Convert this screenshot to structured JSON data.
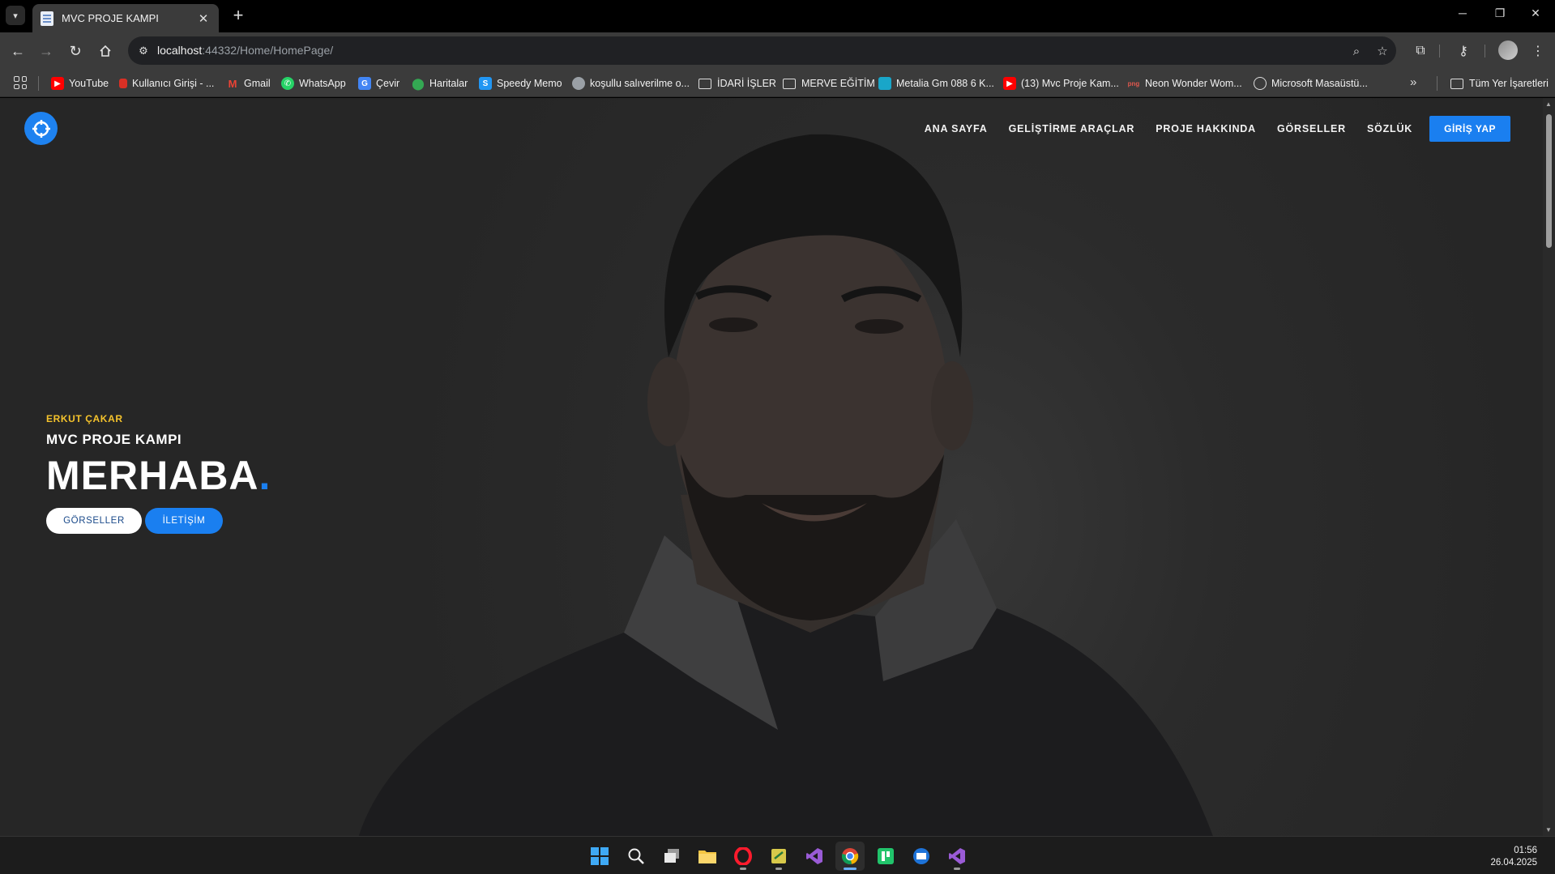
{
  "browser": {
    "tab": {
      "title": "MVC PROJE KAMPI"
    },
    "url": {
      "host": "localhost",
      "path": ":44332/Home/HomePage/"
    },
    "bookmarks": [
      {
        "label": "YouTube",
        "icon": "youtube-icon",
        "color": "#ff0000"
      },
      {
        "label": "Kullanıcı Girişi - ...",
        "icon": "user-login-icon",
        "color": "#d93025"
      },
      {
        "label": "Gmail",
        "icon": "gmail-icon",
        "color": "#ea4335"
      },
      {
        "label": "WhatsApp",
        "icon": "whatsapp-icon",
        "color": "#25d366"
      },
      {
        "label": "Çevir",
        "icon": "translate-icon",
        "color": "#4285f4"
      },
      {
        "label": "Haritalar",
        "icon": "maps-icon",
        "color": "#34a853"
      },
      {
        "label": "Speedy Memo",
        "icon": "speedy-memo-icon",
        "color": "#2196f3"
      },
      {
        "label": "koşullu salıverilme o...",
        "icon": "globe-icon",
        "color": "#9aa0a6"
      },
      {
        "label": "İDARİ İŞLER",
        "icon": "folder-icon",
        "color": ""
      },
      {
        "label": "MERVE EĞİTİM",
        "icon": "folder-icon",
        "color": ""
      },
      {
        "label": "Metalia Gm 088 6 K...",
        "icon": "metalia-icon",
        "color": "#19a6c9"
      },
      {
        "label": "(13) Mvc Proje Kam...",
        "icon": "youtube-icon",
        "color": "#ff0000"
      },
      {
        "label": "Neon Wonder Wom...",
        "icon": "png-icon",
        "color": "#e0584e"
      },
      {
        "label": "Microsoft Masaüstü...",
        "icon": "openai-icon",
        "color": "#dddddd"
      }
    ],
    "bookmarks_other": "Tüm Yer İşaretleri"
  },
  "site": {
    "nav": [
      "ANA SAYFA",
      "GELİŞTİRME ARAÇLAR",
      "PROJE HAKKINDA",
      "GÖRSELLER",
      "SÖZLÜK"
    ],
    "login_label": "GİRİŞ YAP",
    "hero": {
      "eyebrow": "ERKUT ÇAKAR",
      "subtitle": "MVC PROJE KAMPI",
      "title": "MERHABA",
      "title_dot": ".",
      "btn_gallery": "GÖRSELLER",
      "btn_contact": "İLETİŞİM"
    },
    "accent": "#1a7ff0",
    "eyebrow_color": "#f5c32c"
  },
  "taskbar": {
    "apps": [
      "windows-start-icon",
      "search-icon",
      "task-view-icon",
      "file-explorer-icon",
      "opera-icon",
      "sticky-app-icon",
      "visual-studio-icon",
      "chrome-icon",
      "app-green-icon",
      "remote-desktop-icon",
      "visual-studio-icon"
    ],
    "time": "01:56",
    "date": "26.04.2025"
  }
}
